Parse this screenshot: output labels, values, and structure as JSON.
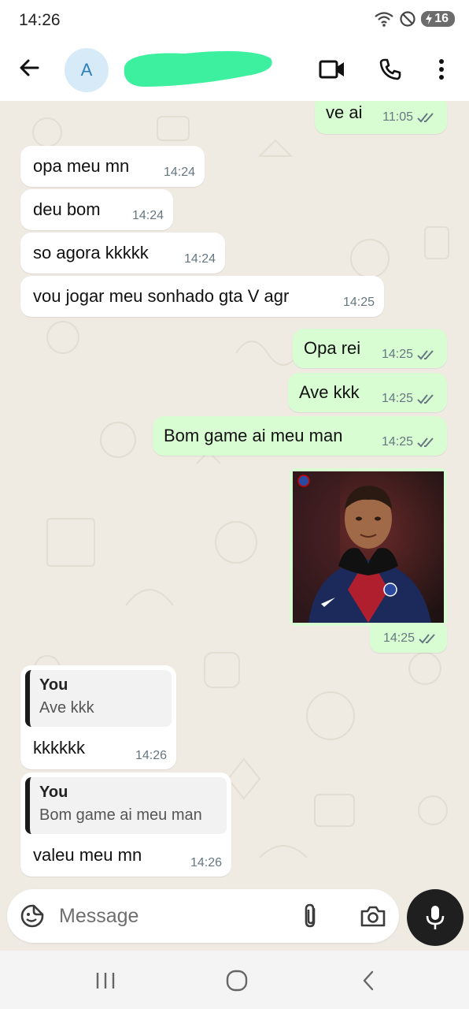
{
  "status_bar": {
    "time": "14:26",
    "battery": "16",
    "icons": [
      "wifi-icon",
      "do-not-disturb-icon",
      "battery-charging-icon"
    ]
  },
  "header": {
    "avatar_letter": "A",
    "contact_name": "",
    "icons": [
      "back-arrow-icon",
      "video-call-icon",
      "phone-icon",
      "more-vertical-icon"
    ]
  },
  "messages": [
    {
      "dir": "out",
      "text": "ve ai",
      "time": "11:05",
      "read": true
    },
    {
      "dir": "in",
      "text": "opa meu mn",
      "time": "14:24"
    },
    {
      "dir": "in",
      "text": "deu bom",
      "time": "14:24"
    },
    {
      "dir": "in",
      "text": "so agora kkkkk",
      "time": "14:24"
    },
    {
      "dir": "in",
      "text": "vou jogar meu sonhado gta V agr",
      "time": "14:25"
    },
    {
      "dir": "out",
      "text": "Opa rei",
      "time": "14:25",
      "read": true
    },
    {
      "dir": "out",
      "text": "Ave kkk",
      "time": "14:25",
      "read": true
    },
    {
      "dir": "out",
      "text": "Bom game ai meu man",
      "time": "14:25",
      "read": true
    },
    {
      "dir": "out",
      "type": "image",
      "time": "14:25",
      "read": true
    },
    {
      "dir": "in",
      "reply_to": {
        "name": "You",
        "text": "Ave kkk"
      },
      "text": "kkkkkk",
      "time": "14:26"
    },
    {
      "dir": "in",
      "reply_to": {
        "name": "You",
        "text": "Bom game ai meu man"
      },
      "text": "valeu meu mn",
      "time": "14:26"
    }
  ],
  "composer": {
    "placeholder": "Message",
    "icons": [
      "emoji-sticker-icon",
      "attach-paperclip-icon",
      "camera-icon",
      "mic-icon"
    ]
  },
  "nav_bar": {
    "icons": [
      "recent-apps-icon",
      "home-icon",
      "back-icon"
    ]
  },
  "colors": {
    "incoming_bubble": "#ffffff",
    "outgoing_bubble": "#d9fdd3",
    "chat_background": "#efeae2",
    "read_ticks": "#667781",
    "name_redaction": "#3df0a0"
  }
}
